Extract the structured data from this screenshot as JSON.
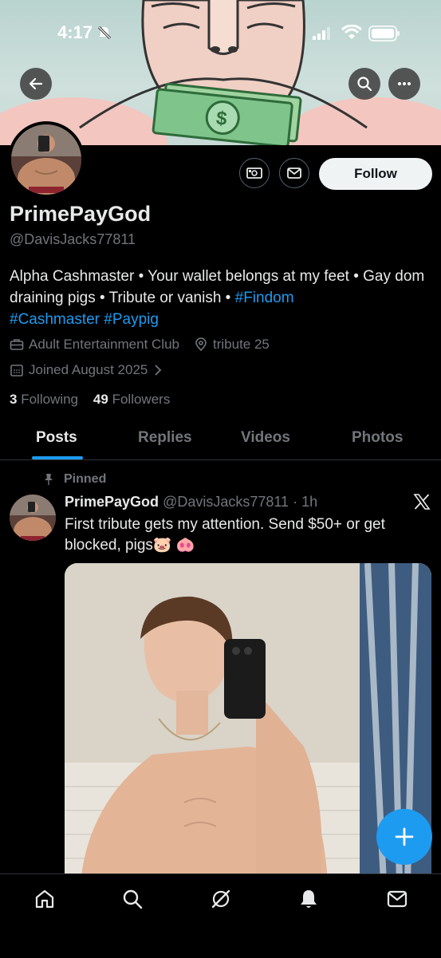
{
  "status_bar": {
    "time": "4:17"
  },
  "profile": {
    "display_name": "PrimePayGod",
    "handle": "@DavisJacks77811",
    "bio_text": "Alpha Cashmaster • Your wallet belongs at my feet • Gay dom draining pigs • Tribute or vanish • ",
    "bio_tags": [
      "#Findom",
      "#Cashmaster",
      "#Paypig"
    ],
    "category": "Adult Entertainment Club",
    "location": "tribute 25",
    "joined": "Joined August 2025",
    "following_count": "3",
    "following_label": "Following",
    "followers_count": "49",
    "followers_label": "Followers",
    "follow_label": "Follow"
  },
  "tabs": [
    {
      "label": "Posts",
      "active": true
    },
    {
      "label": "Replies",
      "active": false
    },
    {
      "label": "Videos",
      "active": false
    },
    {
      "label": "Photos",
      "active": false
    }
  ],
  "post": {
    "pinned_label": "Pinned",
    "author": "PrimePayGod",
    "handle_time": "@DavisJacks77811 · 1h",
    "text": "First tribute gets my attention. Send $50+ or get blocked, pigs🐷 🐽"
  },
  "icons": {
    "back": "arrow-left-icon",
    "search": "search-icon",
    "more": "more-horizontal-icon",
    "tip": "money-icon",
    "message": "envelope-icon",
    "x_logo": "x-logo-icon",
    "compose": "plus-icon",
    "nav": [
      "home-icon",
      "search-icon",
      "grok-icon",
      "bell-icon",
      "mail-icon"
    ]
  },
  "colors": {
    "accent": "#1d9bf0",
    "background": "#000000",
    "secondary_text": "#71767b"
  }
}
